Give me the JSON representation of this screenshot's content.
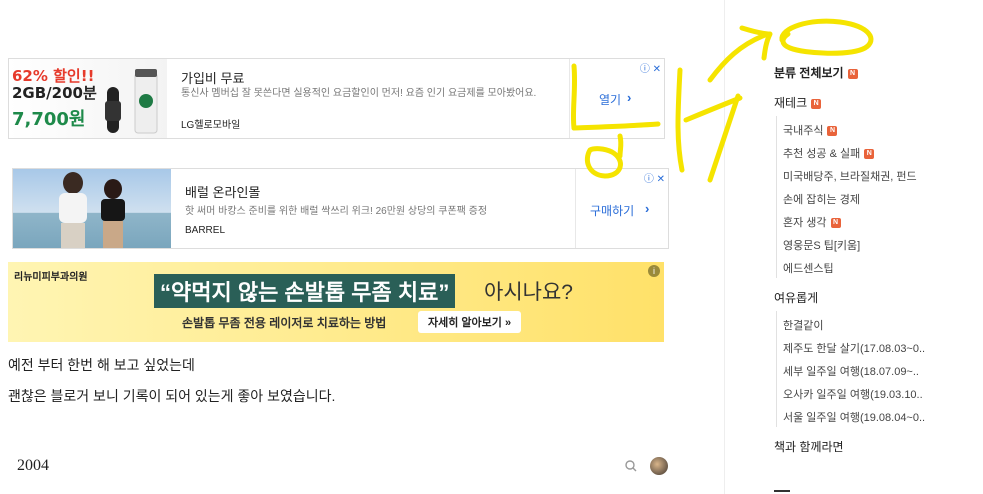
{
  "ads": {
    "ad1": {
      "promo_line1": "62% 할인!!",
      "promo_line2": "2GB/200분",
      "promo_price": "7,700원",
      "title": "가입비 무료",
      "description": "통신사 멤버십 잘 못쓴다면 실용적인 요금할인이 먼저! 요즘 인기 요금제를 모아봤어요.",
      "brand": "LG헬로모바일",
      "cta": "열기"
    },
    "ad2": {
      "title": "배럴 온라인몰",
      "description": "핫 써머 바캉스 준비를 위한 배럴 싹쓰리 위크! 26만원 상당의 쿠폰팩 증정",
      "brand": "BARREL",
      "cta": "구매하기"
    },
    "ad3": {
      "logo": "리뉴미피부과의원",
      "headline": "“약먹지 않는 손발톱 무좀 치료”",
      "headline_suffix": "아시나요?",
      "subline": "손발톱 무좀 전용 레이저로 치료하는 방법",
      "button": "자세히 알아보기 »"
    }
  },
  "content": {
    "paragraph1": "예전 부터 한번 해 보고 싶었는데",
    "paragraph2": "괜찮은 블로거 보니 기록이 되어 있는게 좋아 보였습니다.",
    "footer_year": "2004"
  },
  "sidebar": {
    "all_categories": "분류 전체보기",
    "categories": [
      {
        "label": "재테크",
        "new": true,
        "children": [
          {
            "label": "국내주식",
            "new": true
          },
          {
            "label": "추천 성공 & 실패",
            "new": true
          },
          {
            "label": "미국배당주, 브라질채권, 펀드",
            "new": false
          },
          {
            "label": "손에 잡히는 경제",
            "new": false
          },
          {
            "label": "혼자 생각",
            "new": true
          },
          {
            "label": "영웅문S 팁[키움]",
            "new": false
          },
          {
            "label": "에드센스팁",
            "new": false
          }
        ]
      },
      {
        "label": "여유롭게",
        "new": false,
        "children": [
          {
            "label": "한결같이",
            "new": false
          },
          {
            "label": "제주도 한달 살기(17.08.03~0..",
            "new": false
          },
          {
            "label": "세부 일주일 여행(18.07.09~..",
            "new": false
          },
          {
            "label": "오사카 일주일 여행(19.03.10..",
            "new": false
          },
          {
            "label": "서울 일주일 여행(19.08.04~0..",
            "new": false
          }
        ]
      },
      {
        "label": "책과 함께라면",
        "new": false,
        "children": []
      }
    ],
    "new_badge": "N"
  },
  "colors": {
    "link_blue": "#2a6dd8",
    "new_badge": "#e9633a",
    "banner_yellow": "#ffe169",
    "banner_green": "#2a5f57",
    "handwriting": "#f5e400"
  },
  "icons": {
    "ad_info": "info-icon",
    "ad_close": "close-icon",
    "search": "search-icon"
  }
}
